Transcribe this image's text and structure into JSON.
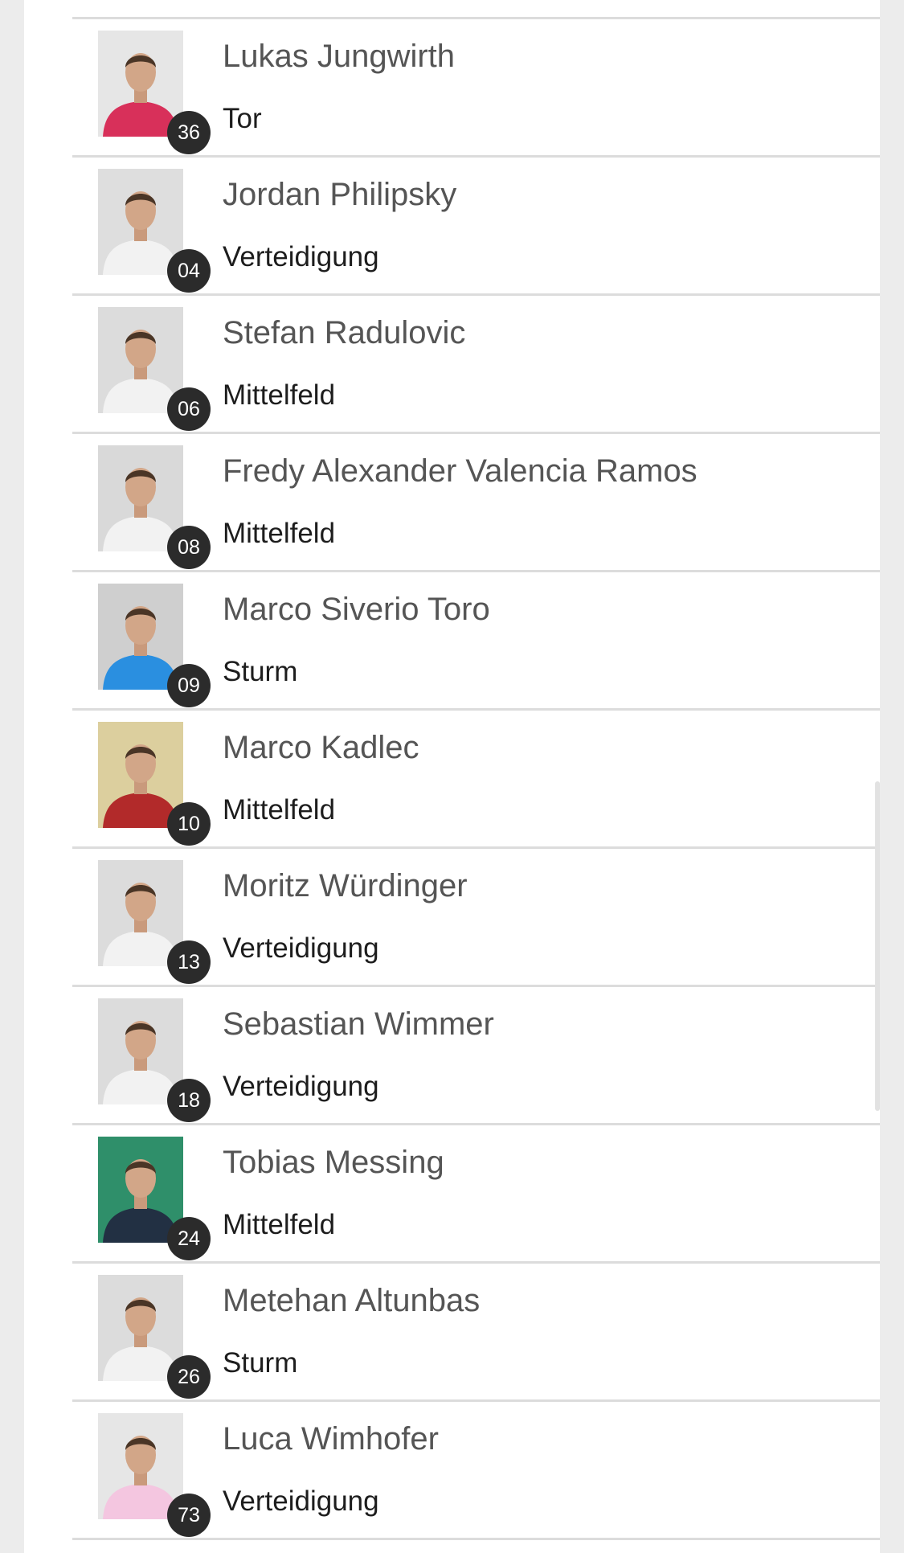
{
  "players": [
    {
      "name": "Lukas Jungwirth",
      "position": "Tor",
      "number": "36",
      "shirt": "#d8305a",
      "bg": "#e6e6e6"
    },
    {
      "name": "Jordan Philipsky",
      "position": "Verteidigung",
      "number": "04",
      "shirt": "#f2f2f2",
      "bg": "#dedede"
    },
    {
      "name": "Stefan Radulovic",
      "position": "Mittelfeld",
      "number": "06",
      "shirt": "#f2f2f2",
      "bg": "#dcdcdc"
    },
    {
      "name": "Fredy Alexander Valencia Ramos",
      "position": "Mittelfeld",
      "number": "08",
      "shirt": "#f2f2f2",
      "bg": "#d9d9d9"
    },
    {
      "name": "Marco Siverio Toro",
      "position": "Sturm",
      "number": "09",
      "shirt": "#2a8fe0",
      "bg": "#cfcfcf"
    },
    {
      "name": "Marco Kadlec",
      "position": "Mittelfeld",
      "number": "10",
      "shirt": "#b22a2a",
      "bg": "#dccf9e"
    },
    {
      "name": "Moritz Würdinger",
      "position": "Verteidigung",
      "number": "13",
      "shirt": "#f2f2f2",
      "bg": "#dcdcdc"
    },
    {
      "name": "Sebastian Wimmer",
      "position": "Verteidigung",
      "number": "18",
      "shirt": "#f2f2f2",
      "bg": "#dcdcdc"
    },
    {
      "name": "Tobias Messing",
      "position": "Mittelfeld",
      "number": "24",
      "shirt": "#223043",
      "bg": "#2f8f6a"
    },
    {
      "name": "Metehan Altunbas",
      "position": "Sturm",
      "number": "26",
      "shirt": "#f2f2f2",
      "bg": "#dcdcdc"
    },
    {
      "name": "Luca Wimhofer",
      "position": "Verteidigung",
      "number": "73",
      "shirt": "#f4c6e0",
      "bg": "#e6e6e6"
    }
  ]
}
